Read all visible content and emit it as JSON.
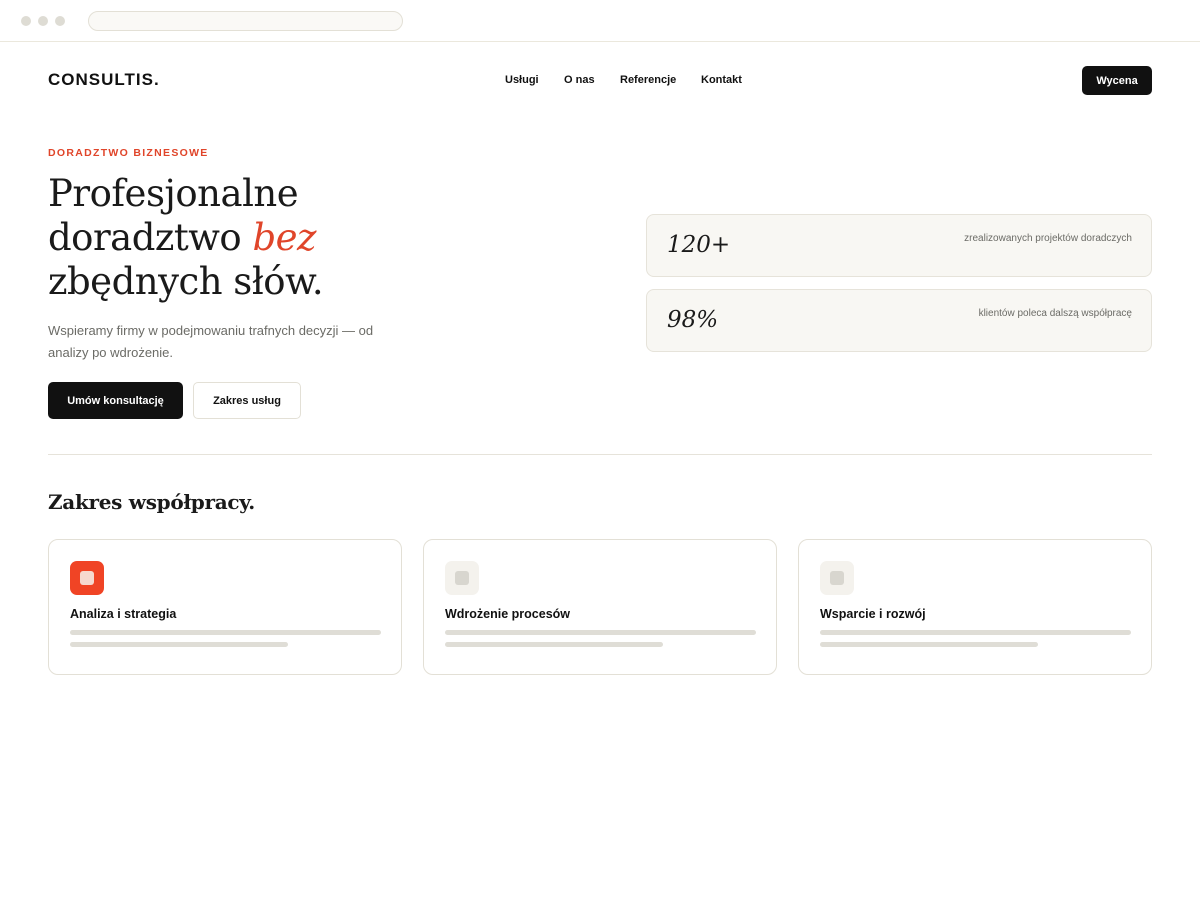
{
  "brand": {
    "logo": "CONSULTIS.",
    "accent": "#e0452a"
  },
  "nav": {
    "items": [
      "Usługi",
      "O nas",
      "Referencje",
      "Kontakt"
    ],
    "cta": "Wycena"
  },
  "hero": {
    "eyebrow": "DORADZTWO BIZNESOWE",
    "title_line1": "Profesjonalne",
    "title_line2_a": "doradztwo ",
    "title_line2_em": "bez",
    "title_line3": "zbędnych słów.",
    "subtitle": "Wspieramy firmy w podejmowaniu trafnych decyzji — od analizy po wdrożenie.",
    "primary_button": "Umów konsultację",
    "secondary_button": "Zakres usług"
  },
  "stats": [
    {
      "value": "120+",
      "label": "zrealizowanych projektów doradczych"
    },
    {
      "value": "98%",
      "label": "klientów poleca dalszą współpracę"
    }
  ],
  "services": {
    "title": "Zakres współpracy.",
    "cards": [
      {
        "title": "Analiza i strategia",
        "icon": "square-icon",
        "active": true
      },
      {
        "title": "Wdrożenie procesów",
        "icon": "square-icon",
        "active": false
      },
      {
        "title": "Wsparcie i rozwój",
        "icon": "square-icon",
        "active": false
      }
    ]
  }
}
